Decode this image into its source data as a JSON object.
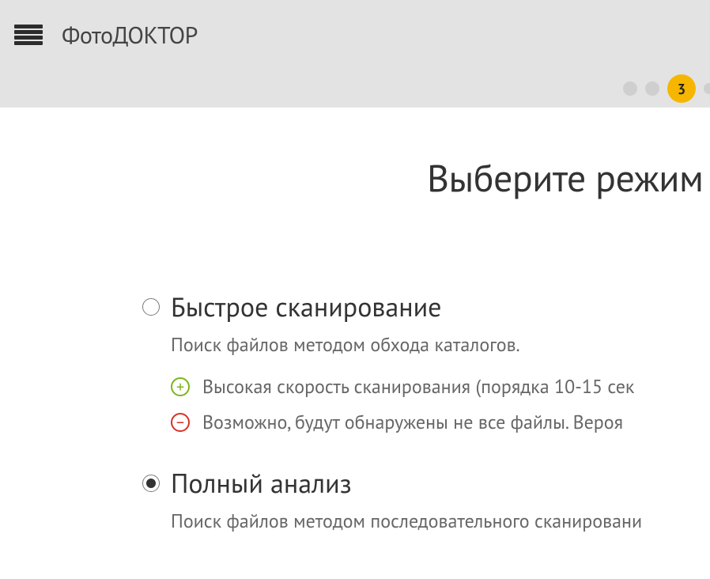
{
  "header": {
    "app_title_prefix": "Фото",
    "app_title_suffix": "ДОКТОР"
  },
  "steps": {
    "active_label": "3"
  },
  "page": {
    "title": "Выберите режим"
  },
  "options": [
    {
      "id": "quick",
      "label": "Быстрое сканирование",
      "desc": "Поиск файлов методом обхода каталогов.",
      "selected": false,
      "bullets": [
        {
          "type": "plus",
          "text": "Высокая скорость сканирования (порядка 10-15 сек"
        },
        {
          "type": "minus",
          "text": "Возможно, будут обнаружены не все файлы. Вероя"
        }
      ]
    },
    {
      "id": "full",
      "label": "Полный анализ",
      "desc": "Поиск файлов методом последовательного сканировани",
      "selected": true,
      "bullets": []
    }
  ]
}
